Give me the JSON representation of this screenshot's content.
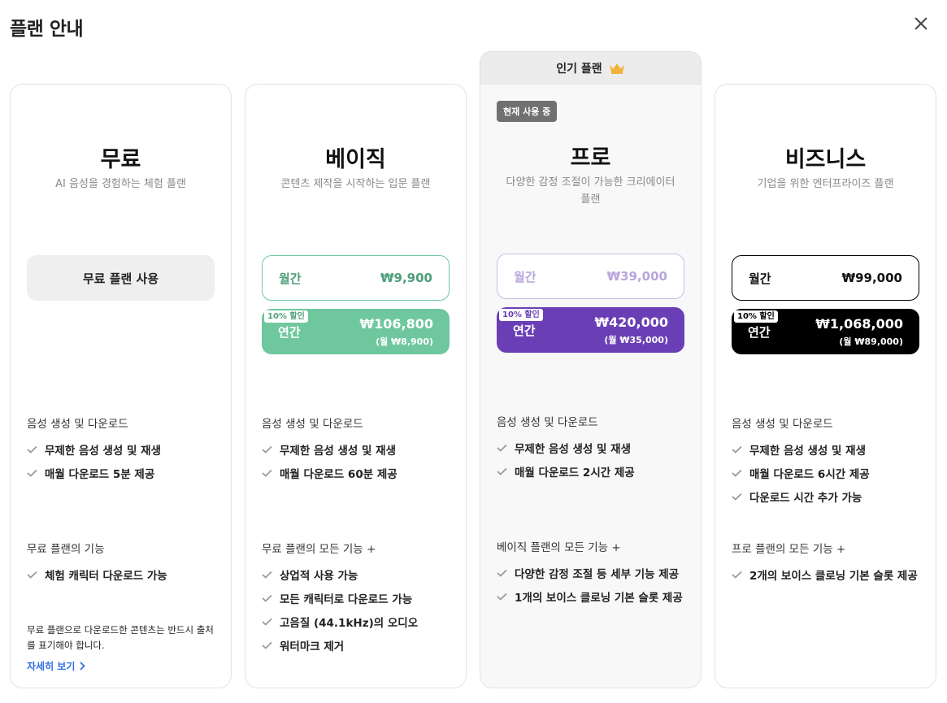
{
  "header": {
    "title": "플랜 안내"
  },
  "popular_tab": {
    "label": "인기 플랜",
    "icon": "crown-icon",
    "icon_color": "#f2b33d"
  },
  "colors": {
    "basic_accent": "#6fc79e",
    "basic_text": "#4f9f7a",
    "pro_accent": "#6a3fb5",
    "pro_muted_text": "#b8a6dd",
    "business_accent": "#000000",
    "link": "#2f6fe0"
  },
  "plans": [
    {
      "name": "무료",
      "desc": "AI 음성을 경험하는 체험 플랜",
      "cta": "무료 플랜 사용",
      "section1": "음성 생성 및 다운로드",
      "features1": [
        "무제한 음성 생성 및 재생",
        "매월 다운로드 5분 제공"
      ],
      "section2": "무료 플랜의 기능",
      "features2": [
        "체험 캐릭터 다운로드 가능"
      ],
      "note": "무료 플랜으로 다운로드한 콘텐츠는 반드시 출처를 표기해야 합니다.",
      "more": "자세히 보기"
    },
    {
      "name": "베이직",
      "desc": "콘텐츠 제작을 시작하는 입문 플랜",
      "monthly_label": "월간",
      "monthly_price": "₩9,900",
      "discount": "10% 할인",
      "annual_label": "연간",
      "annual_price": "₩106,800",
      "annual_monthly": "(월 ₩8,900)",
      "section1": "음성 생성 및 다운로드",
      "features1": [
        "무제한 음성 생성 및 재생",
        "매월 다운로드 60분 제공"
      ],
      "section2": "무료 플랜의 모든 기능 +",
      "features2": [
        "상업적 사용 가능",
        "모든 캐릭터로 다운로드 가능",
        "고음질 (44.1kHz)의 오디오",
        "워터마크 제거"
      ]
    },
    {
      "name": "프로",
      "badge": "현재 사용 중",
      "desc": "다양한 감정 조절이 가능한 크리에이터 플랜",
      "monthly_label": "월간",
      "monthly_price": "₩39,000",
      "discount": "10% 할인",
      "annual_label": "연간",
      "annual_price": "₩420,000",
      "annual_monthly": "(월 ₩35,000)",
      "section1": "음성 생성 및 다운로드",
      "features1": [
        "무제한 음성 생성 및 재생",
        "매월 다운로드 2시간 제공"
      ],
      "section2": "베이직 플랜의 모든 기능 +",
      "features2": [
        "다양한 감정 조절 등 세부 기능 제공",
        "1개의 보이스 클로닝 기본 슬롯 제공"
      ]
    },
    {
      "name": "비즈니스",
      "desc": "기업을 위한 엔터프라이즈 플랜",
      "monthly_label": "월간",
      "monthly_price": "₩99,000",
      "discount": "10% 할인",
      "annual_label": "연간",
      "annual_price": "₩1,068,000",
      "annual_monthly": "(월 ₩89,000)",
      "section1": "음성 생성 및 다운로드",
      "features1": [
        "무제한 음성 생성 및 재생",
        "매월 다운로드 6시간 제공",
        "다운로드 시간 추가 가능"
      ],
      "section2": "프로 플랜의 모든 기능 +",
      "features2": [
        "2개의 보이스 클로닝 기본 슬롯 제공"
      ]
    }
  ]
}
